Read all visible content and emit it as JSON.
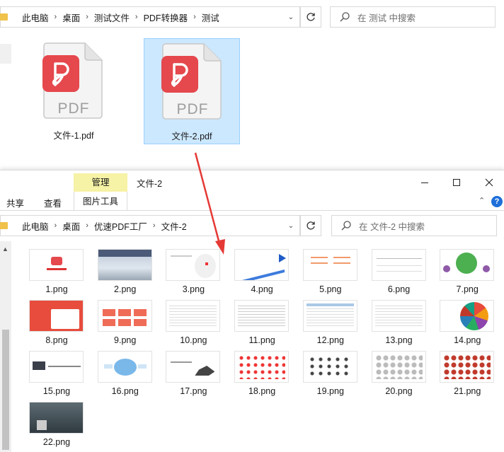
{
  "top_window": {
    "breadcrumb": [
      "此电脑",
      "桌面",
      "测试文件",
      "PDF转换器",
      "测试"
    ],
    "search_placeholder": "在 测试 中搜索",
    "files": [
      {
        "name": "文件-1.pdf",
        "selected": false
      },
      {
        "name": "文件-2.pdf",
        "selected": true
      }
    ]
  },
  "bottom_window": {
    "context_tab": "管理",
    "title": "文件-2",
    "ribbon_tabs": [
      "共享",
      "查看",
      "图片工具"
    ],
    "breadcrumb": [
      "此电脑",
      "桌面",
      "优速PDF工厂",
      "文件-2"
    ],
    "search_placeholder": "在 文件-2 中搜索",
    "help": "?",
    "images": [
      "1.png",
      "2.png",
      "3.png",
      "4.png",
      "5.png",
      "6.png",
      "7.png",
      "8.png",
      "9.png",
      "10.png",
      "11.png",
      "12.png",
      "13.png",
      "14.png",
      "15.png",
      "16.png",
      "17.png",
      "18.png",
      "19.png",
      "20.png",
      "21.png",
      "22.png"
    ]
  },
  "colors": {
    "selection": "#cce8ff",
    "pdf_red": "#e5484d",
    "context_tab": "#f6f2a6",
    "annotation_arrow": "#e53935"
  }
}
